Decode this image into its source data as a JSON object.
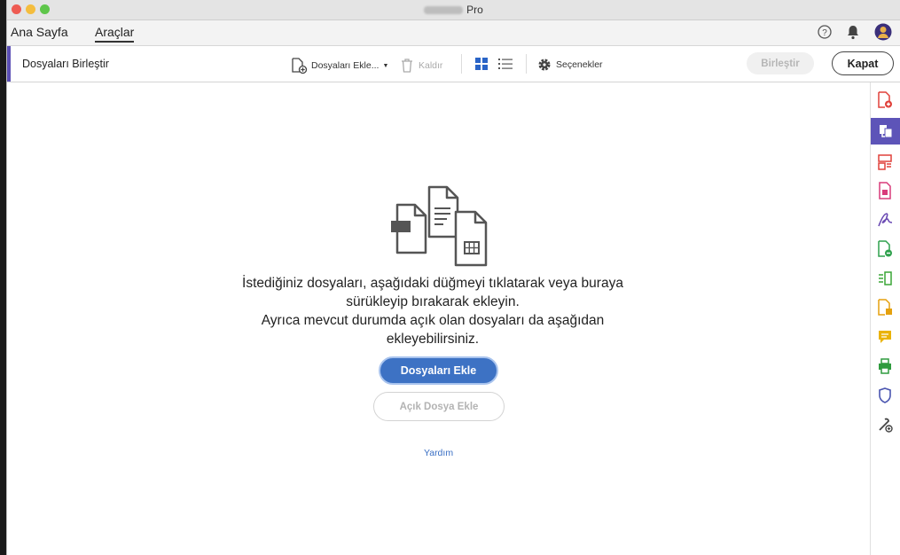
{
  "window": {
    "title": "Pro"
  },
  "nav": {
    "tabs": [
      {
        "label": "Ana Sayfa"
      },
      {
        "label": "Araçlar"
      }
    ]
  },
  "toolbar": {
    "tool_title": "Dosyaları Birleştir",
    "add_files": "Dosyaları Ekle...",
    "remove": "Kaldır",
    "options": "Seçenekler",
    "combine": "Birleştir",
    "close": "Kapat"
  },
  "main": {
    "message_lines": [
      "İstediğiniz dosyaları, aşağıdaki düğmeyi tıklatarak veya buraya",
      "sürükleyip bırakarak ekleyin.",
      "Ayrıca mevcut durumda açık olan dosyaları da aşağıdan",
      "ekleyebilirsiniz."
    ],
    "add_files_button": "Dosyaları Ekle",
    "add_open_file_button": "Açık Dosya Ekle",
    "help_link": "Yardım"
  },
  "icons": {
    "right_rail": [
      "create-pdf-icon",
      "combine-files-icon",
      "organize-pages-icon",
      "export-pdf-icon",
      "fill-sign-icon",
      "edit-pdf-icon",
      "compare-icon",
      "export-icon",
      "comment-icon",
      "print-production-icon",
      "protect-icon",
      "more-tools-icon"
    ],
    "nav": [
      "help-icon",
      "bell-icon",
      "avatar"
    ]
  },
  "colors": {
    "accent": "#5b4fb5",
    "primary_button": "#3d72c4",
    "link": "#3a6fc4"
  }
}
